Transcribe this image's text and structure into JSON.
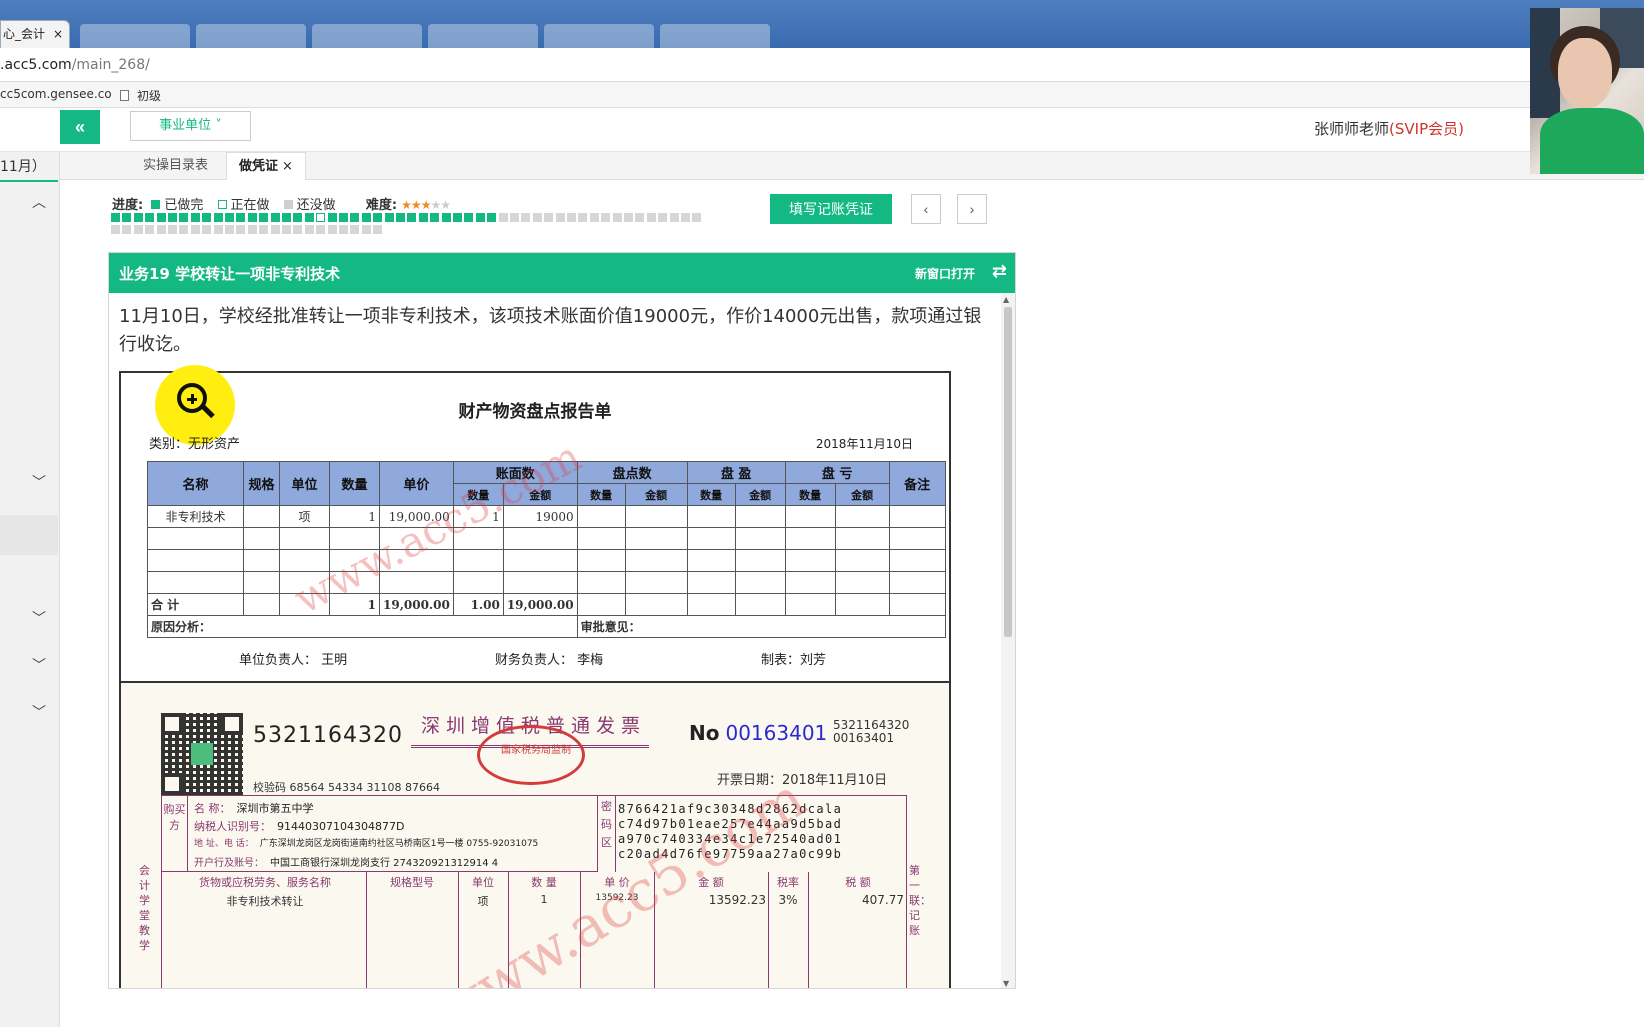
{
  "browser": {
    "active_tab_title": "心_会计",
    "close_glyph": "×",
    "url_host": ".acc5.com",
    "url_path": "/main_268/",
    "bookmarks": [
      "cc5com.gensee.co",
      "初级"
    ]
  },
  "header": {
    "collapse_glyph": "«",
    "unit_select": "事业单位",
    "user_name": "张师师老师",
    "user_badge": "(SVIP会员)"
  },
  "sidebar": {
    "month": "11月）"
  },
  "page_tabs": [
    {
      "label": "实操目录表",
      "active": false
    },
    {
      "label": "做凭证",
      "active": true,
      "close": "×"
    }
  ],
  "progress": {
    "label": "进度:",
    "done_label": "已做完",
    "doing_label": "正在做",
    "todo_label": "还没做",
    "difficulty_label": "难度:",
    "difficulty_stars": 3,
    "difficulty_max": 5,
    "total_tasks": 76,
    "done_tasks": 19,
    "current_task": 19
  },
  "toolbar": {
    "fill_voucher": "填写记账凭证",
    "prev": "‹",
    "next": "›"
  },
  "task": {
    "title": "业务19 学校转让一项非专利技术",
    "new_window": "新窗口打开",
    "swap_glyph": "⇄",
    "description": "11月10日，学校经批准转让一项非专利技术，该项技术账面价值19000元，作价14000元出售，款项通过银行收讫。"
  },
  "report": {
    "title": "财产物资盘点报告单",
    "category": "类别：无形资产",
    "date": "2018年11月10日",
    "headers": {
      "name": "名称",
      "spec": "规格",
      "unit": "单位",
      "qty": "数量",
      "price": "单价",
      "book": "账面数",
      "count": "盘点数",
      "surplus": "盘  盈",
      "loss": "盘  亏",
      "remark": "备注",
      "sub_qty": "数量",
      "sub_amt": "金额"
    },
    "row": {
      "name": "非专利技术",
      "unit": "项",
      "qty": "1",
      "price": "19,000.00",
      "book_qty": "1",
      "book_amt": "19000"
    },
    "total": {
      "label": "合    计",
      "qty": "1",
      "price": "19,000.00",
      "book_qty": "1.00",
      "book_amt": "19,000.00"
    },
    "reason_label": "原因分析：",
    "approval_label": "审批意见：",
    "sign_head": "单位负责人：  王明",
    "sign_finance": "财务负责人：  李梅",
    "sign_maker": "制表：刘芳"
  },
  "invoice": {
    "code": "5321164320",
    "title": "深圳增值税普通发票",
    "seal_text": "国家税务局监制",
    "no_label": "No",
    "no_value": "00163401",
    "no_small_1": "5321164320",
    "no_small_2": "00163401",
    "issue_date": "开票日期：2018年11月10日",
    "check_code": "校验码 68564 54334 31108 87664",
    "buyer_side": "购买方",
    "buyer": [
      {
        "label": "名        称：",
        "value": "深圳市第五中学"
      },
      {
        "label": "纳税人识别号：",
        "value": "91440307104304877D"
      },
      {
        "label": "地 址、电 话：",
        "value": "广东深圳龙岗区龙岗街道南约社区马桥南区1号一楼 0755-92031075"
      },
      {
        "label": "开户行及账号：",
        "value": "中国工商银行深圳龙岗支行 274320921312914 4"
      }
    ],
    "pwd_side": "密码区",
    "pwd": [
      "8766421af9c30348d2862dcala",
      "c74d97b01eae257e44aa9d5bad",
      "a970c740334e34c1e72540ad01",
      "c20ad4d76fe97759aa27a0c99b"
    ],
    "goods_headers": [
      "货物或应税劳务、服务名称",
      "规格型号",
      "单位",
      "数 量",
      "单 价",
      "金 额",
      "税率",
      "税 额"
    ],
    "goods_row": [
      "非专利技术转让",
      "",
      "项",
      "1",
      "13592.23",
      "13592.23",
      "3%",
      "407.77"
    ],
    "left_margin": "会计学堂教学",
    "right_margin": "第一联：记账"
  },
  "watermark": "www.acc5.com"
}
